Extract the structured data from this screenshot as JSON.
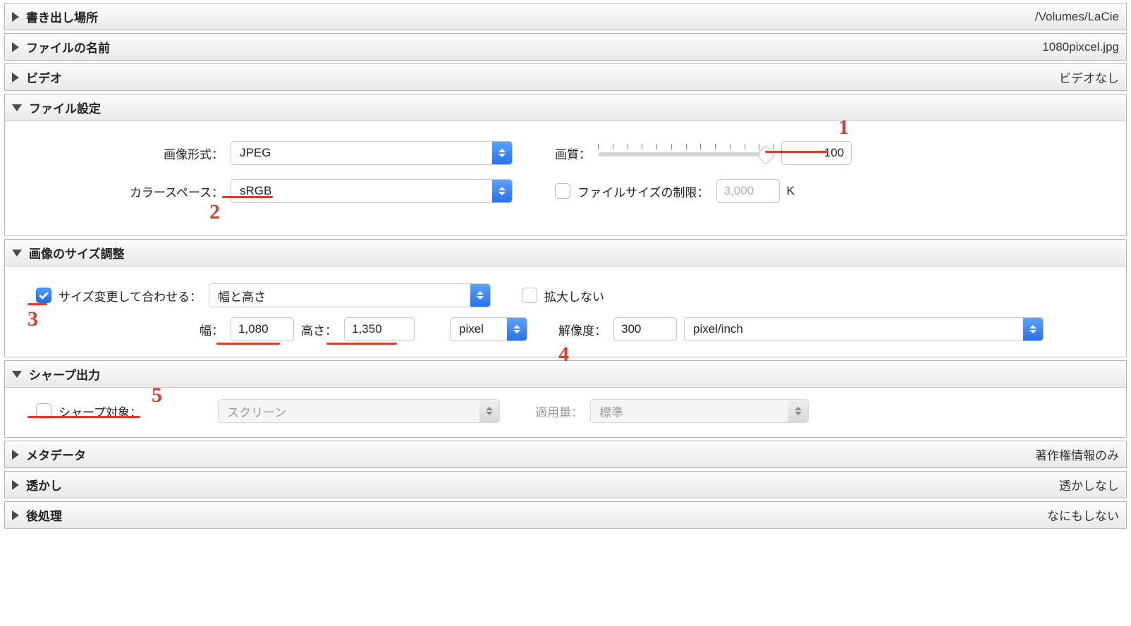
{
  "panels": {
    "export_location": {
      "title": "書き出し場所",
      "summary": "/Volumes/LaCie"
    },
    "file_name": {
      "title": "ファイルの名前",
      "summary": "1080pixcel.jpg"
    },
    "video": {
      "title": "ビデオ",
      "summary": "ビデオなし"
    },
    "file_settings": {
      "title": "ファイル設定"
    },
    "image_sizing": {
      "title": "画像のサイズ調整"
    },
    "output_sharpening": {
      "title": "シャープ出力"
    },
    "metadata": {
      "title": "メタデータ",
      "summary": "著作権情報のみ"
    },
    "watermark": {
      "title": "透かし",
      "summary": "透かしなし"
    },
    "post_process": {
      "title": "後処理",
      "summary": "なにもしない"
    }
  },
  "file_settings": {
    "image_format_label": "画像形式：",
    "image_format_value": "JPEG",
    "quality_label": "画質：",
    "quality_value": "100",
    "color_space_label": "カラースペース：",
    "color_space_value": "sRGB",
    "limit_label": "ファイルサイズの制限：",
    "limit_placeholder": "3,000",
    "limit_unit": "K"
  },
  "image_sizing": {
    "resize_label": "サイズ変更して合わせる：",
    "resize_mode": "幅と高さ",
    "no_enlarge_label": "拡大しない",
    "w_label": "幅：",
    "w_value": "1,080",
    "h_label": "高さ：",
    "h_value": "1,350",
    "unit_value": "pixel",
    "resolution_label": "解像度：",
    "resolution_value": "300",
    "resolution_unit": "pixel/inch"
  },
  "sharpen": {
    "enable_label": "シャープ対象：",
    "target_value": "スクリーン",
    "amount_label": "適用量：",
    "amount_value": "標準"
  },
  "annotations": {
    "a1": "1",
    "a2": "2",
    "a3": "3",
    "a4": "4",
    "a5": "5"
  }
}
